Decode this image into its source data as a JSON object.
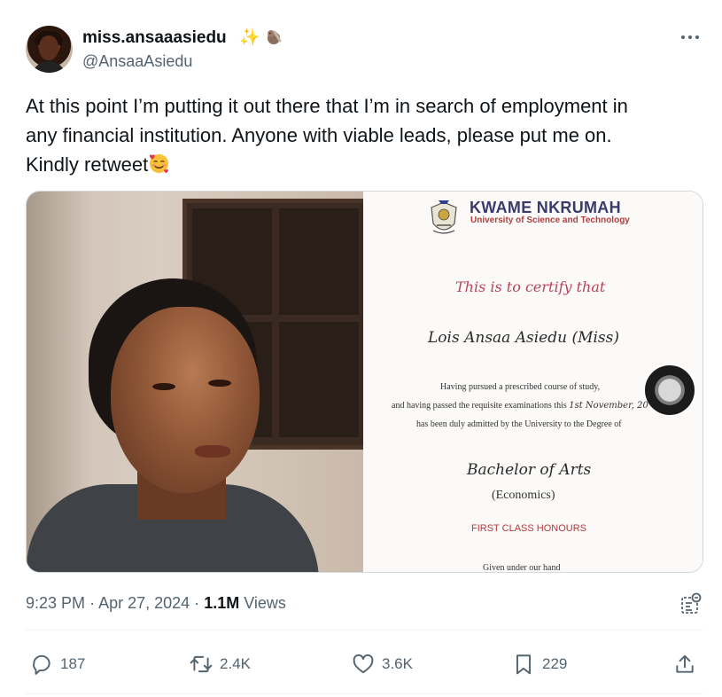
{
  "author": {
    "display_name": "miss.ansaaasiedu",
    "name_emoji": "✨",
    "handle": "@AnsaaAsiedu"
  },
  "tweet": {
    "text_line1": "At this point I’m putting it out there that I’m in search of employment in",
    "text_line2": "any financial institution. Anyone with viable leads, please put me on.",
    "text_line3": "Kindly retweet",
    "time": "9:23 PM",
    "separator": "·",
    "date": "Apr 27, 2024",
    "views_count": "1.1M",
    "views_label": "Views"
  },
  "certificate": {
    "university_name": "KWAME NKRUMAH",
    "university_sub": "University of Science and Technology",
    "certify_line": "This is to certify that",
    "recipient": "Lois Ansaa Asiedu (Miss)",
    "line1": "Having pursued a prescribed course of study,",
    "line2_pre": "and having passed the requisite examinations this",
    "line2_date": "1st November, 20",
    "line3": "has been duly admitted by the University to the Degree of",
    "degree": "Bachelor of Arts",
    "major": "(Economics)",
    "honours": "FIRST CLASS HONOURS",
    "given": "Given under our hand"
  },
  "actions": {
    "replies": "187",
    "reposts": "2.4K",
    "likes": "3.6K",
    "bookmarks": "229"
  },
  "icons": [
    "more-icon",
    "analytics-icon",
    "reply-icon",
    "repost-icon",
    "like-icon",
    "bookmark-icon",
    "share-icon"
  ],
  "colors": {
    "text": "#0f1419",
    "secondary": "#536471",
    "border": "#cfd9de"
  }
}
